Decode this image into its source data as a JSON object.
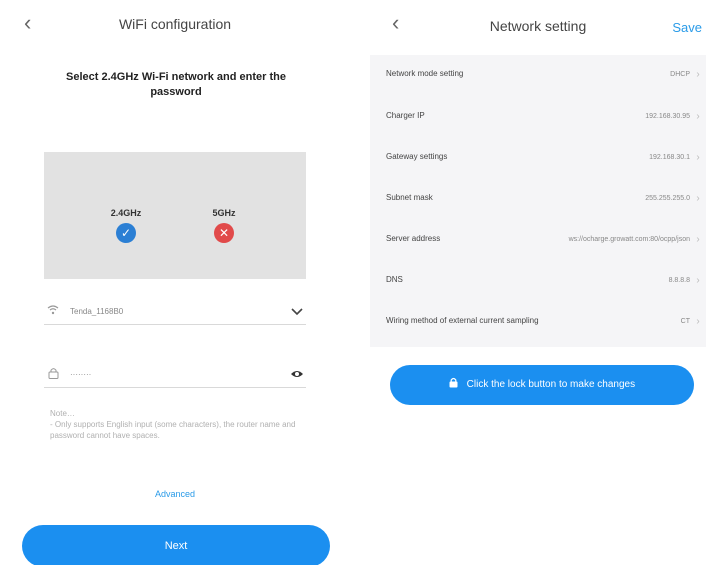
{
  "wifi": {
    "back_glyph": "‹",
    "title": "WiFi configuration",
    "instruction": "Select 2.4GHz Wi-Fi network and enter the password",
    "band_24_label": "2.4GHz",
    "band_24_mark": "✓",
    "band_5_label": "5GHz",
    "band_5_mark": "✕",
    "ssid_value": "Tenda_1168B0",
    "ssid_icon": "wifi-icon",
    "password_value": "········",
    "password_icon": "lock-icon",
    "eye_glyph": "👁",
    "note": "Note…\n- Only supports English input (some characters), the router name and password cannot have spaces.",
    "advanced_label": "Advanced",
    "next_label": "Next",
    "band_24_color": "#2b7fd4",
    "band_5_color": "#e14a4a"
  },
  "network": {
    "back_glyph": "‹",
    "title": "Network setting",
    "save_label": "Save",
    "rows": [
      {
        "label": "Network mode setting",
        "value": "DHCP"
      },
      {
        "label": "Charger IP",
        "value": "192.168.30.95"
      },
      {
        "label": "Gateway settings",
        "value": "192.168.30.1"
      },
      {
        "label": "Subnet mask",
        "value": "255.255.255.0"
      },
      {
        "label": "Server address",
        "value": "ws://ocharge.growatt.com:80/ocpp/json"
      },
      {
        "label": "DNS",
        "value": "8.8.8.8"
      },
      {
        "label": "Wiring method of external current sampling",
        "value": "CT"
      }
    ],
    "lock_button_label": "Click the lock button to make changes",
    "accent_color": "#1b8ff0"
  }
}
